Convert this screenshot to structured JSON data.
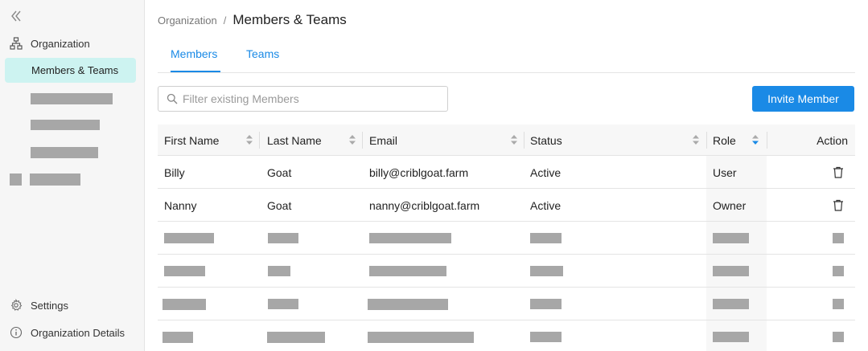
{
  "sidebar": {
    "collapse_icon": "double-chevron-left-icon",
    "org_icon": "hierarchy-icon",
    "org_label": "Organization",
    "active_item": "Members & Teams",
    "settings_icon": "gear-icon",
    "settings_label": "Settings",
    "details_icon": "info-icon",
    "details_label": "Organization Details"
  },
  "breadcrumb": {
    "parent": "Organization",
    "separator": "/",
    "current": "Members & Teams"
  },
  "tabs": [
    {
      "label": "Members",
      "active": true
    },
    {
      "label": "Teams",
      "active": false
    }
  ],
  "filter": {
    "placeholder": "Filter existing Members",
    "value": "",
    "icon": "search-icon"
  },
  "invite_label": "Invite Member",
  "table": {
    "columns": [
      "First Name",
      "Last Name",
      "Email",
      "Status",
      "Role",
      "Action"
    ],
    "sorted_column": "Role",
    "rows": [
      {
        "first": "Billy",
        "last": "Goat",
        "email": "billy@criblgoat.farm",
        "status": "Active",
        "role": "User"
      },
      {
        "first": "Nanny",
        "last": "Goat",
        "email": "nanny@criblgoat.farm",
        "status": "Active",
        "role": "Owner"
      }
    ],
    "action_icon": "trash-icon"
  },
  "colors": {
    "accent": "#1a8ae6",
    "active_nav": "#cdf3f1",
    "redaction": "#a7a7a7"
  }
}
